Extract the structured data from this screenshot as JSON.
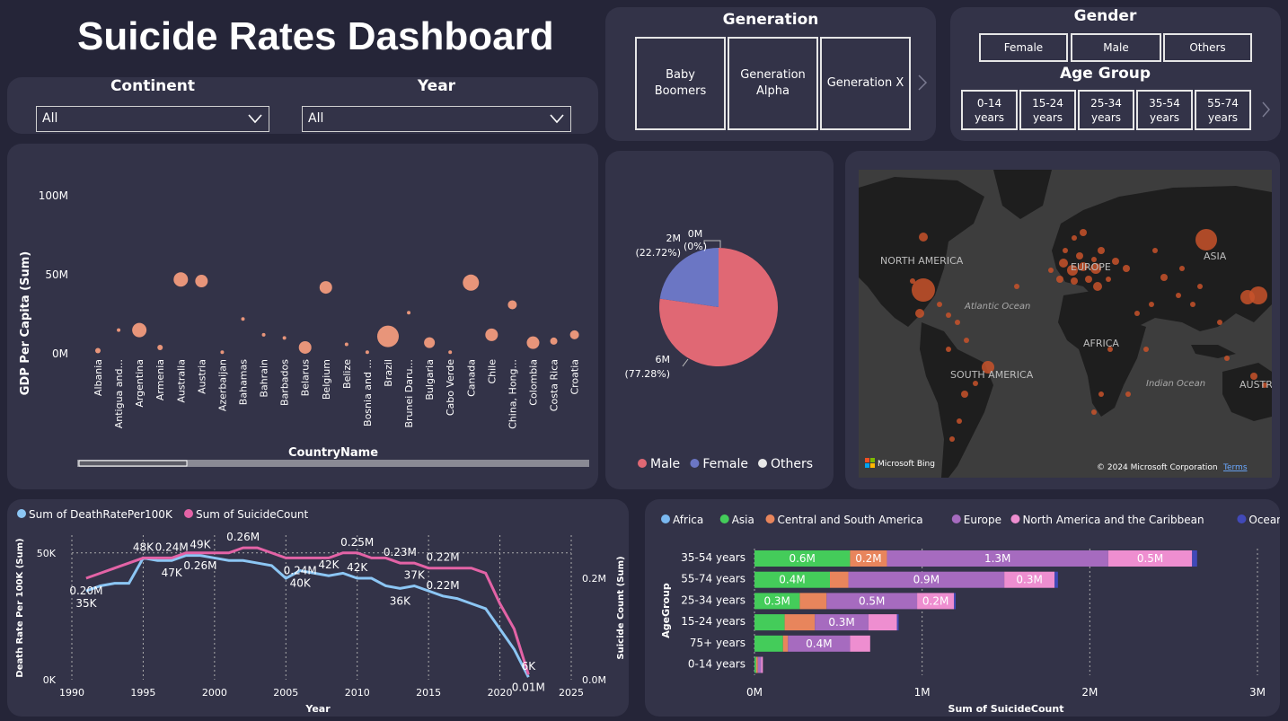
{
  "header": {
    "title": "Suicide Rates Dashboard"
  },
  "filters": {
    "continent": {
      "label": "Continent",
      "value": "All"
    },
    "year": {
      "label": "Year",
      "value": "All"
    }
  },
  "generation": {
    "label": "Generation",
    "tiles": [
      {
        "line1": "Baby",
        "line2": "Boomers"
      },
      {
        "line1": "Generation",
        "line2": "Alpha"
      },
      {
        "line1": "Generation X",
        "line2": ""
      }
    ]
  },
  "gender": {
    "label": "Gender",
    "options": [
      "Female",
      "Male",
      "Others"
    ]
  },
  "age_group": {
    "label": "Age Group",
    "options": [
      {
        "line1": "0-14",
        "line2": "years"
      },
      {
        "line1": "15-24",
        "line2": "years"
      },
      {
        "line1": "25-34",
        "line2": "years"
      },
      {
        "line1": "35-54",
        "line2": "years"
      },
      {
        "line1": "55-74",
        "line2": "years"
      }
    ]
  },
  "map": {
    "labels": {
      "north_america": "NORTH AMERICA",
      "south_america": "SOUTH AMERICA",
      "europe": "EUROPE",
      "africa": "AFRICA",
      "asia": "ASIA",
      "australia": "AUSTR",
      "atlantic": "Atlantic Ocean",
      "indian": "Indian Ocean"
    },
    "brand": "Microsoft Bing",
    "copyright": "© 2024 Microsoft Corporation",
    "terms": "Terms",
    "colors": {
      "land": "#1e1e1e",
      "ocean": "#3d3d3d",
      "bubble": "#c8522a"
    }
  },
  "chart_data": [
    {
      "type": "scatter",
      "xlabel": "CountryName",
      "ylabel": "GDP Per Capita (Sum)",
      "y_ticks": [
        "0M",
        "50M",
        "100M"
      ],
      "ylim": [
        0,
        100
      ],
      "color": "#e8957a",
      "categories": [
        "Albania",
        "Antigua and...",
        "Argentina",
        "Armenia",
        "Australia",
        "Austria",
        "Azerbaijan",
        "Bahamas",
        "Bahrain",
        "Barbados",
        "Belarus",
        "Belgium",
        "Belize",
        "Bosnia and ...",
        "Brazil",
        "Brunei Daru...",
        "Bulgaria",
        "Cabo Verde",
        "Canada",
        "Chile",
        "China, Hong...",
        "Colombia",
        "Costa Rica",
        "Croatia"
      ],
      "values": [
        2,
        15,
        15,
        4,
        47,
        46,
        1,
        22,
        12,
        10,
        4,
        42,
        6,
        1,
        11,
        26,
        7,
        1,
        45,
        12,
        31,
        7,
        8,
        12
      ],
      "sizes": [
        3,
        2,
        8,
        3,
        8,
        7,
        2,
        2,
        2,
        2,
        7,
        7,
        2,
        2,
        12,
        2,
        6,
        2,
        9,
        7,
        5,
        7,
        4,
        5
      ]
    },
    {
      "type": "pie",
      "legend": [
        "Male",
        "Female",
        "Others"
      ],
      "colors": [
        "#e06874",
        "#6b76c4",
        "#e8e8e8"
      ],
      "values": [
        77.28,
        22.72,
        0
      ],
      "labels": [
        {
          "value": "6M",
          "pct": "(77.28%)"
        },
        {
          "value": "2M",
          "pct": "(22.72%)"
        },
        {
          "value": "0M",
          "pct": "(0%)"
        }
      ]
    },
    {
      "type": "line",
      "xlabel": "Year",
      "ylabel_left": "Death Rate Per 100K (Sum)",
      "ylabel_right": "Suicide Count (Sum)",
      "left_ticks": [
        "0K",
        "50K"
      ],
      "right_ticks": [
        "0.0M",
        "0.2M"
      ],
      "x_ticks": [
        "1990",
        "1995",
        "2000",
        "2005",
        "2010",
        "2015",
        "2020",
        "2025"
      ],
      "x": [
        1991,
        1992,
        1993,
        1994,
        1995,
        1996,
        1997,
        1998,
        1999,
        2000,
        2001,
        2002,
        2003,
        2004,
        2005,
        2006,
        2007,
        2008,
        2009,
        2010,
        2011,
        2012,
        2013,
        2014,
        2015,
        2016,
        2017,
        2018,
        2019,
        2020,
        2021,
        2022
      ],
      "series": [
        {
          "name": "Sum of DeathRatePer100K",
          "color": "#8cc6f4",
          "values": [
            35,
            37,
            38,
            38,
            48,
            47,
            47,
            49,
            49,
            48,
            47,
            47,
            46,
            45,
            40,
            43,
            42,
            41,
            42,
            40,
            40,
            37,
            36,
            37,
            35,
            33,
            32,
            30,
            28,
            20,
            12,
            1
          ]
        },
        {
          "name": "Sum of SuicideCount",
          "color": "#e363a6",
          "values": [
            0.2,
            0.21,
            0.22,
            0.23,
            0.24,
            0.24,
            0.24,
            0.25,
            0.25,
            0.25,
            0.25,
            0.26,
            0.26,
            0.25,
            0.24,
            0.24,
            0.24,
            0.24,
            0.25,
            0.25,
            0.24,
            0.24,
            0.23,
            0.23,
            0.22,
            0.22,
            0.22,
            0.22,
            0.21,
            0.15,
            0.1,
            0.01
          ]
        }
      ],
      "data_labels": [
        {
          "text": "0.20M",
          "series": 1,
          "x": 1991,
          "pos": "below"
        },
        {
          "text": "35K",
          "series": 0,
          "x": 1991,
          "pos": "below"
        },
        {
          "text": "48K",
          "series": 0,
          "x": 1995,
          "pos": "above"
        },
        {
          "text": "0.24M",
          "series": 1,
          "x": 1997,
          "pos": "above"
        },
        {
          "text": "47K",
          "series": 0,
          "x": 1997,
          "pos": "below"
        },
        {
          "text": "49K",
          "series": 0,
          "x": 1999,
          "pos": "above"
        },
        {
          "text": "0.26M",
          "series": 1,
          "x": 1999,
          "pos": "below"
        },
        {
          "text": "0.26M",
          "series": 1,
          "x": 2002,
          "pos": "above"
        },
        {
          "text": "0.24M",
          "series": 1,
          "x": 2006,
          "pos": "below"
        },
        {
          "text": "40K",
          "series": 0,
          "x": 2006,
          "pos": "below"
        },
        {
          "text": "42K",
          "series": 0,
          "x": 2008,
          "pos": "above"
        },
        {
          "text": "0.25M",
          "series": 1,
          "x": 2010,
          "pos": "above"
        },
        {
          "text": "42K",
          "series": 0,
          "x": 2010,
          "pos": "above"
        },
        {
          "text": "0.23M",
          "series": 1,
          "x": 2013,
          "pos": "above"
        },
        {
          "text": "37K",
          "series": 0,
          "x": 2014,
          "pos": "above"
        },
        {
          "text": "36K",
          "series": 0,
          "x": 2013,
          "pos": "below"
        },
        {
          "text": "0.22M",
          "series": 1,
          "x": 2016,
          "pos": "above"
        },
        {
          "text": "0.22M",
          "series": 0,
          "x": 2016,
          "pos": "above"
        },
        {
          "text": "6K",
          "series": 0,
          "x": 2022,
          "pos": "above"
        },
        {
          "text": "0.01M",
          "series": 1,
          "x": 2022,
          "pos": "below"
        }
      ]
    },
    {
      "type": "bar",
      "orientation": "horizontal",
      "stacked": true,
      "xlabel": "Sum of SuicideCount",
      "ylabel": "AgeGroup",
      "x_ticks": [
        "0M",
        "1M",
        "2M",
        "3M"
      ],
      "xlim": [
        0,
        3
      ],
      "categories": [
        "35-54 years",
        "55-74 years",
        "25-34 years",
        "15-24 years",
        "75+ years",
        "0-14 years"
      ],
      "series": [
        {
          "name": "Africa",
          "color": "#7ab8f0",
          "values": [
            0.0,
            0.0,
            0.0,
            0.0,
            0.0,
            0.0
          ]
        },
        {
          "name": "Asia",
          "color": "#44cc5a",
          "values": [
            0.57,
            0.45,
            0.27,
            0.18,
            0.17,
            0.01
          ]
        },
        {
          "name": "Central and South America",
          "color": "#e8855c",
          "values": [
            0.22,
            0.11,
            0.16,
            0.18,
            0.03,
            0.01
          ]
        },
        {
          "name": "Europe",
          "color": "#a66bbf",
          "values": [
            1.32,
            0.93,
            0.54,
            0.32,
            0.37,
            0.02
          ]
        },
        {
          "name": "North America and the Caribbean",
          "color": "#ee8ed0",
          "values": [
            0.5,
            0.3,
            0.22,
            0.17,
            0.12,
            0.01
          ]
        },
        {
          "name": "Oceania",
          "color": "#4149b8",
          "values": [
            0.03,
            0.02,
            0.01,
            0.01,
            0.0,
            0.0
          ]
        }
      ],
      "data_labels": [
        [
          "",
          "0.6M",
          "0.2M",
          "1.3M",
          "0.5M",
          ""
        ],
        [
          "",
          "0.4M",
          "",
          "0.9M",
          "0.3M",
          ""
        ],
        [
          "",
          "0.3M",
          "",
          "0.5M",
          "0.2M",
          ""
        ],
        [
          "",
          "",
          "",
          "0.3M",
          "",
          ""
        ],
        [
          "",
          "",
          "",
          "0.4M",
          "",
          ""
        ],
        [
          "",
          "",
          "",
          "",
          "",
          ""
        ]
      ]
    }
  ]
}
